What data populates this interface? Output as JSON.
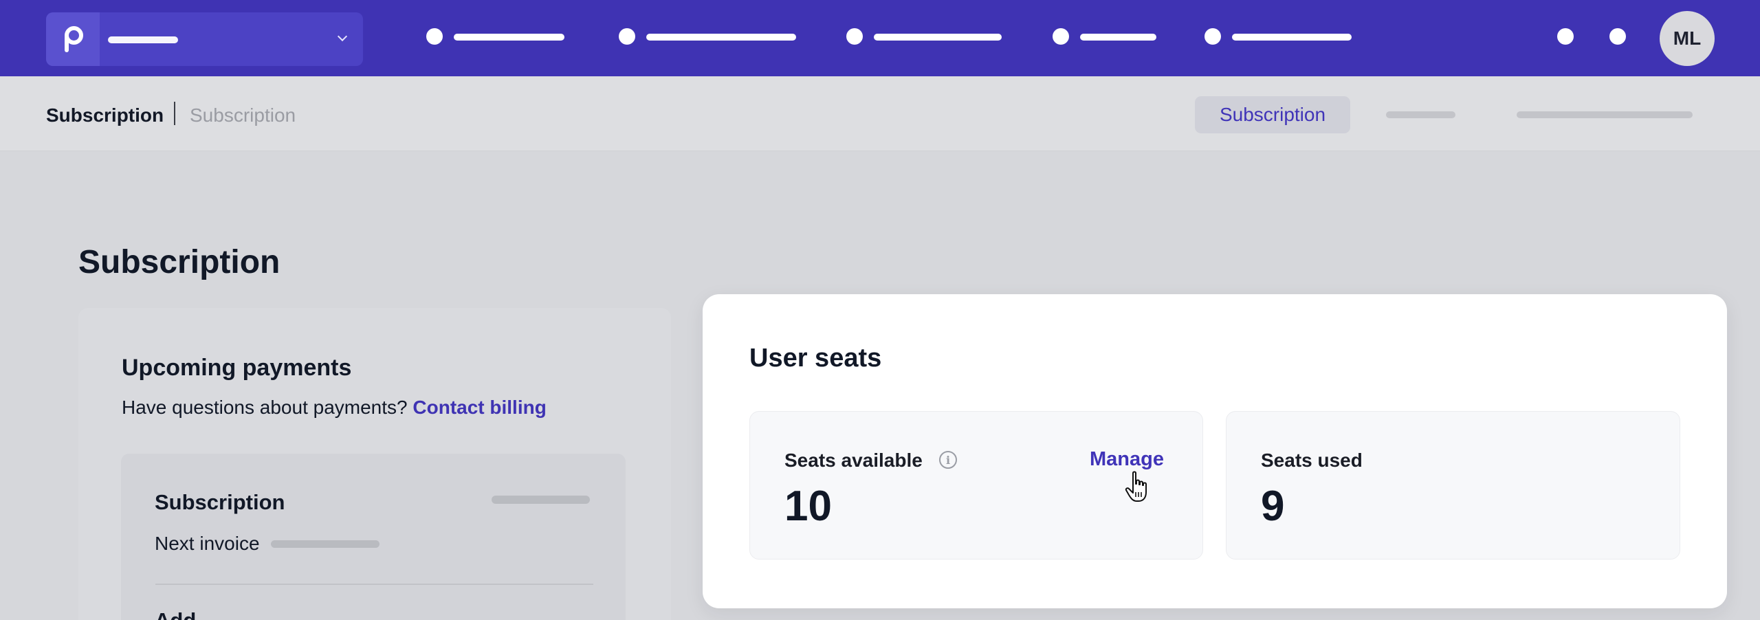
{
  "header": {
    "avatar_initials": "ML",
    "nav_item_count": 5
  },
  "breadcrumb": {
    "current": "Subscription",
    "parent": "Subscription"
  },
  "subnav": {
    "active_tab": "Subscription"
  },
  "page": {
    "title": "Subscription"
  },
  "upcoming_payments": {
    "title": "Upcoming payments",
    "question": "Have questions about payments?",
    "contact_link": "Contact billing",
    "subscription_title": "Subscription",
    "next_invoice_label": "Next invoice",
    "truncated_heading": "Add"
  },
  "user_seats": {
    "title": "User seats",
    "available_label": "Seats available",
    "available_value": "10",
    "manage_label": "Manage",
    "used_label": "Seats used",
    "used_value": "9"
  },
  "colors": {
    "nav_bg": "#3f33b3",
    "accent": "#4034b8"
  }
}
